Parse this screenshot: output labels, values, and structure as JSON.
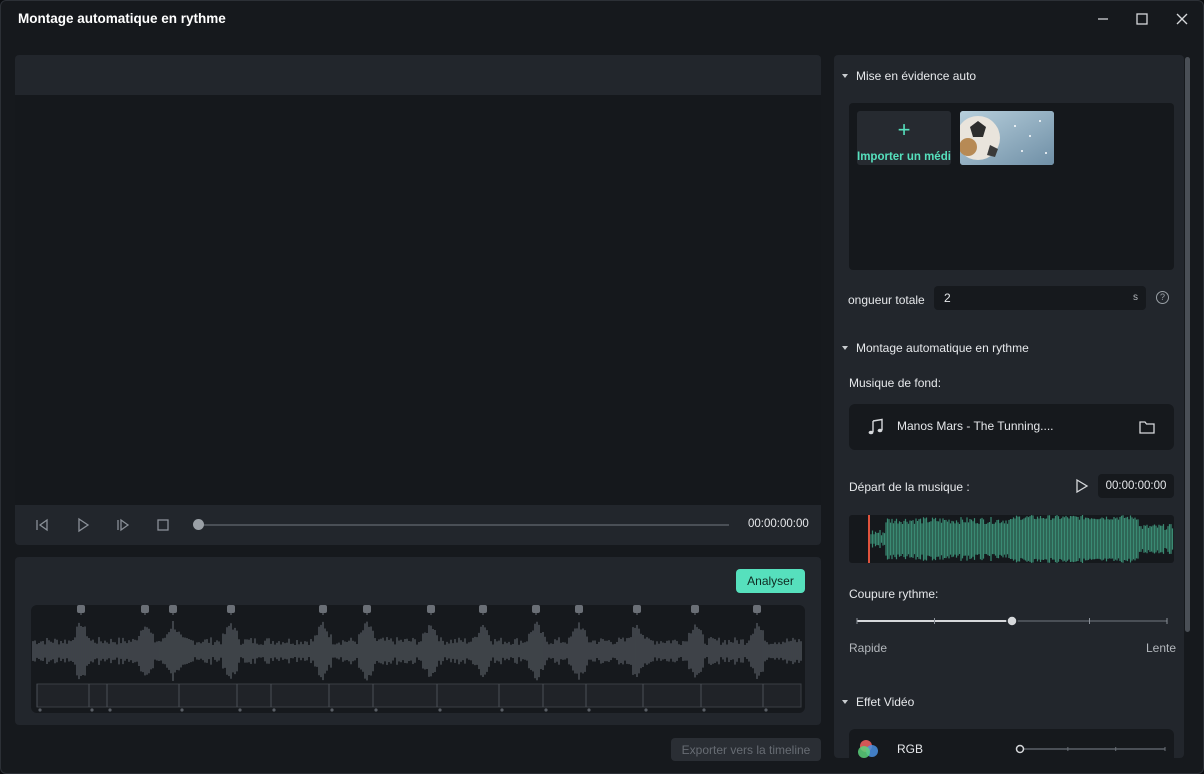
{
  "window": {
    "title": "Montage automatique en rythme"
  },
  "preview": {
    "timecode": "00:00:00:00"
  },
  "beat": {
    "analyze_label": "Analyser"
  },
  "export_label": "Exporter vers la timeline",
  "right": {
    "auto_highlight": {
      "title": "Mise en évidence auto",
      "import_label": "Importer un média"
    },
    "duration": {
      "label": "ongueur totale",
      "value": "2",
      "unit": "s"
    },
    "beat_sync": {
      "title": "Montage automatique en rythme",
      "bg_music_label": "Musique de fond:",
      "music_name": "Manos Mars - The Tunning....",
      "start_label": "Départ de la musique :",
      "start_time": "00:00:00:00",
      "cut_label": "Coupure rythme:",
      "cut_level": 0.5,
      "slider_min_label": "Rapide",
      "slider_max_label": "Lente"
    },
    "video_effect": {
      "title": "Effet Vidéo",
      "effect_name": "RGB",
      "effect_level": 0
    }
  },
  "colors": {
    "accent": "#56e0bd",
    "playhead": "#e0533d",
    "wave_green": "#3a8a73"
  }
}
